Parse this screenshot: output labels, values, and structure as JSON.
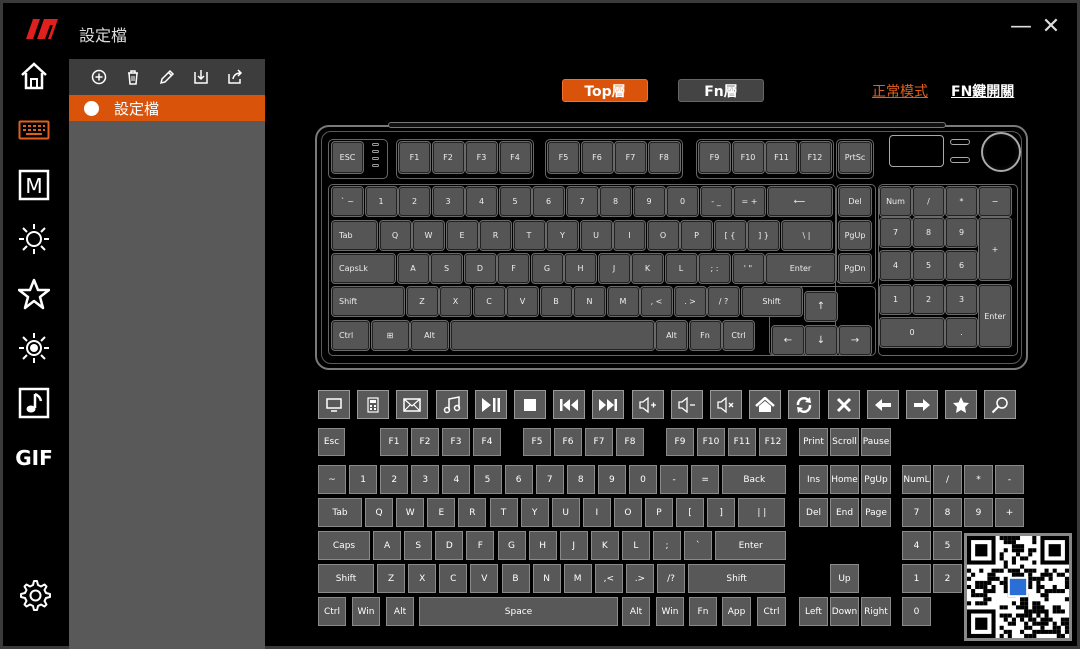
{
  "app": {
    "title": "設定檔"
  },
  "window": {
    "minimize": "—",
    "close": "✕"
  },
  "colors": {
    "accent": "#d9530a",
    "panel": "#595959",
    "key": "#555555"
  },
  "sidebar": {
    "items": [
      {
        "name": "home-icon"
      },
      {
        "name": "keyboard-icon"
      },
      {
        "name": "macro-icon",
        "label": "M"
      },
      {
        "name": "brightness-icon"
      },
      {
        "name": "star-icon"
      },
      {
        "name": "light-effect-icon"
      },
      {
        "name": "music-note-icon"
      },
      {
        "name": "gif-icon",
        "label": "GIF"
      },
      {
        "name": "gear-icon"
      }
    ]
  },
  "profiles": {
    "toolbar": [
      "add-icon",
      "trash-icon",
      "edit-icon",
      "import-icon",
      "export-icon"
    ],
    "items": [
      {
        "label": "設定檔"
      }
    ]
  },
  "layers": {
    "top": "Top層",
    "fn": "Fn層"
  },
  "modes": {
    "normal": "正常模式",
    "fn_switch": "FN鍵開關"
  },
  "graphic_keys": {
    "esc": "ESC",
    "f1": "F1",
    "f2": "F2",
    "f3": "F3",
    "f4": "F4",
    "f5": "F5",
    "f6": "F6",
    "f7": "F7",
    "f8": "F8",
    "f9": "F9",
    "f10": "F10",
    "f11": "F11",
    "f12": "F12",
    "prtsc": "PrtSc",
    "r1": [
      "` ~",
      "1",
      "2",
      "3",
      "4",
      "5",
      "6",
      "7",
      "8",
      "9",
      "0",
      "- _",
      "= +",
      "⟵"
    ],
    "r2": [
      "Tab",
      "Q",
      "W",
      "E",
      "R",
      "T",
      "Y",
      "U",
      "I",
      "O",
      "P",
      "[ {",
      "] }",
      "\\ |"
    ],
    "r3": [
      "CapsLk",
      "A",
      "S",
      "D",
      "F",
      "G",
      "H",
      "J",
      "K",
      "L",
      "; :",
      "' \"",
      "Enter"
    ],
    "r4": [
      "Shift",
      "Z",
      "X",
      "C",
      "V",
      "B",
      "N",
      "M",
      ", <",
      ". >",
      "/ ?",
      "Shift"
    ],
    "r5": [
      "Ctrl",
      "⊞",
      "Alt",
      "",
      "Alt",
      "Fn",
      "Ctrl"
    ],
    "nav": [
      "Del",
      "PgUp",
      "PgDn"
    ],
    "arrows": [
      "↑",
      "←",
      "↓",
      "→"
    ],
    "num": [
      "Num",
      "/",
      "*",
      "−",
      "7",
      "8",
      "9",
      "+",
      "4",
      "5",
      "6",
      "1",
      "2",
      "3",
      "Enter",
      "0",
      "."
    ]
  },
  "media_keys": [
    "monitor-icon",
    "calculator-icon",
    "mail-icon",
    "music-icon",
    "play-pause-icon",
    "stop-icon",
    "previous-track-icon",
    "next-track-icon",
    "volume-up-icon",
    "volume-down-icon",
    "mute-icon",
    "home-page-icon",
    "refresh-icon",
    "close-x-icon",
    "back-arrow-icon",
    "forward-arrow-icon",
    "favorite-star-icon",
    "search-icon"
  ],
  "lower_keys": {
    "frow": [
      "Esc",
      "F1",
      "F2",
      "F3",
      "F4",
      "F5",
      "F6",
      "F7",
      "F8",
      "F9",
      "F10",
      "F11",
      "F12",
      "Print",
      "Scroll",
      "Pause"
    ],
    "r1": [
      "~",
      "1",
      "2",
      "3",
      "4",
      "5",
      "6",
      "7",
      "8",
      "9",
      "0",
      "-",
      "=",
      "Back"
    ],
    "nav1": [
      "Ins",
      "Home",
      "PgUp"
    ],
    "num1": [
      "NumL",
      "/",
      "*",
      "-"
    ],
    "r2": [
      "Tab",
      "Q",
      "W",
      "E",
      "R",
      "T",
      "Y",
      "U",
      "I",
      "O",
      "P",
      "[",
      "]",
      "| |"
    ],
    "nav2": [
      "Del",
      "End",
      "Page"
    ],
    "num2": [
      "7",
      "8",
      "9",
      "+"
    ],
    "r3": [
      "Caps",
      "A",
      "S",
      "D",
      "F",
      "G",
      "H",
      "J",
      "K",
      "L",
      ";",
      "`",
      "Enter"
    ],
    "num3": [
      "4",
      "5"
    ],
    "r4": [
      "Shift",
      "Z",
      "X",
      "C",
      "V",
      "B",
      "N",
      "M",
      ",<",
      ".>",
      "/?",
      "Shift"
    ],
    "up": "Up",
    "num4": [
      "1",
      "2"
    ],
    "r5": [
      "Ctrl",
      "Win",
      "Alt",
      "Space",
      "Alt",
      "Win",
      "Fn",
      "App",
      "Ctrl"
    ],
    "arrows": [
      "Left",
      "Down",
      "Right"
    ],
    "num5": [
      "0"
    ]
  }
}
